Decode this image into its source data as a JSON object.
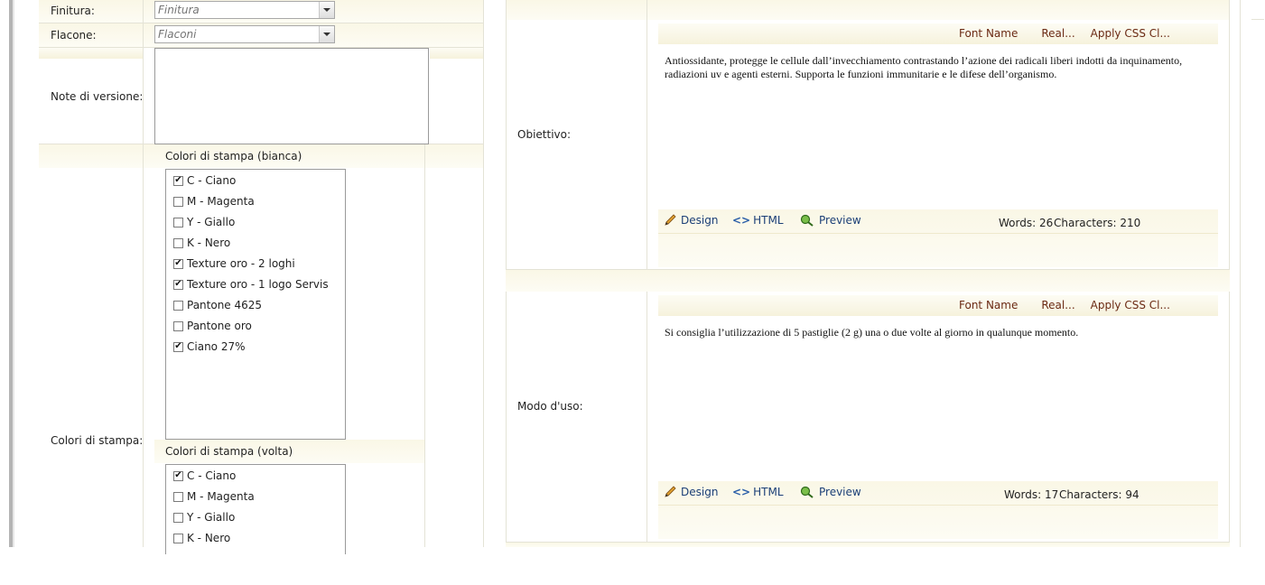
{
  "left_form": {
    "finitura": {
      "label": "Finitura:",
      "placeholder": "Finitura"
    },
    "flacone": {
      "label": "Flacone:",
      "placeholder": "Flaconi"
    },
    "note": {
      "label": "Note di versione:",
      "value": ""
    },
    "colori": {
      "label": "Colori di stampa:",
      "bianca": {
        "title": "Colori di stampa (bianca)",
        "items": [
          {
            "label": "C - Ciano",
            "checked": true
          },
          {
            "label": "M - Magenta",
            "checked": false
          },
          {
            "label": "Y - Giallo",
            "checked": false
          },
          {
            "label": "K - Nero",
            "checked": false
          },
          {
            "label": "Texture oro - 2 loghi",
            "checked": true
          },
          {
            "label": "Texture oro - 1 logo Servis",
            "checked": true
          },
          {
            "label": "Pantone 4625",
            "checked": false
          },
          {
            "label": "Pantone oro",
            "checked": false
          },
          {
            "label": "Ciano 27%",
            "checked": true
          }
        ]
      },
      "volta": {
        "title": "Colori di stampa (volta)",
        "items": [
          {
            "label": "C - Ciano",
            "checked": true
          },
          {
            "label": "M - Magenta",
            "checked": false
          },
          {
            "label": "Y - Giallo",
            "checked": false
          },
          {
            "label": "K - Nero",
            "checked": false
          }
        ]
      }
    }
  },
  "right_form": {
    "obiettivo": {
      "label": "Obiettivo:",
      "toolbar": {
        "font_name": "Font Name",
        "real": "Real...",
        "apply_css": "Apply CSS Cl..."
      },
      "content": "Antiossidante, protegge le cellule dall’invecchiamento contrastando l’azione dei radicali liberi indotti da inquinamento, radiazioni uv e agenti esterni. Supporta le funzioni immunitarie e le difese dell’organismo.",
      "modes": {
        "design": "Design",
        "html": "HTML",
        "preview": "Preview"
      },
      "words": "Words: 26",
      "characters": "Characters: 210"
    },
    "modo_uso": {
      "label": "Modo d'uso:",
      "toolbar": {
        "font_name": "Font Name",
        "real": "Real...",
        "apply_css": "Apply CSS Cl..."
      },
      "content": "Si consiglia l’utilizzazione di 5 pastiglie (2 g) una o due volte al giorno in qualunque momento.",
      "modes": {
        "design": "Design",
        "html": "HTML",
        "preview": "Preview"
      },
      "words": "Words: 17",
      "characters": "Characters: 94"
    }
  },
  "colors": {
    "toolbar_text": "#6b2a14",
    "mode_text": "#1b3f77",
    "cream": "#faf7e6"
  }
}
